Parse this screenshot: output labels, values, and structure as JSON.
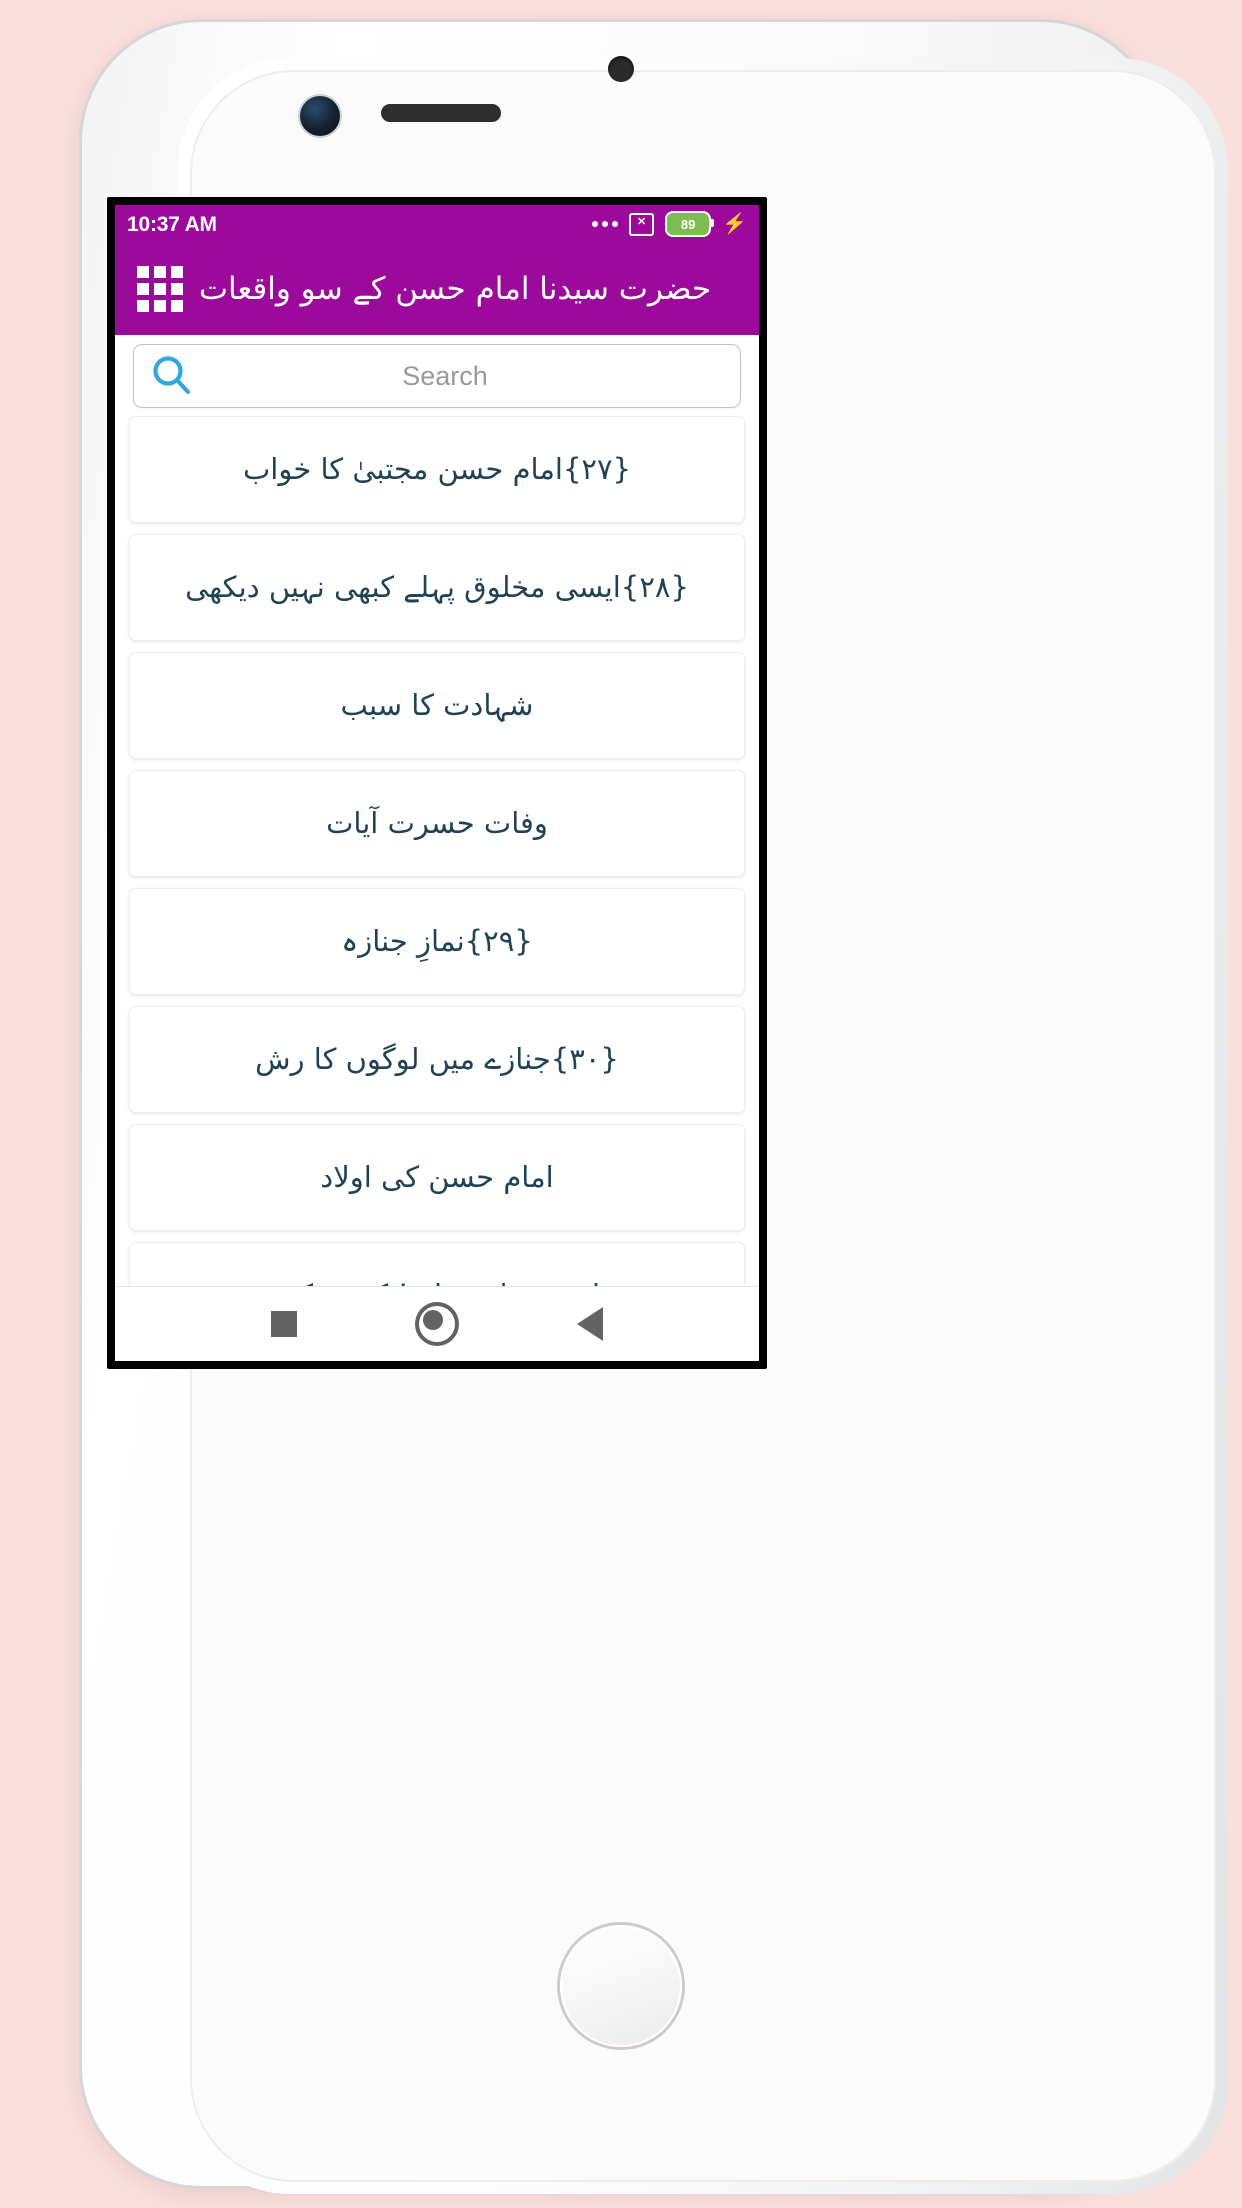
{
  "status_bar": {
    "time": "10:37 AM",
    "overflow_icon": "more-dots-icon",
    "no_sim_icon": "no-sim-icon",
    "no_sim_glyph": "✕",
    "battery_level": "89",
    "charging_icon": "bolt-icon",
    "charging_glyph": "⚡"
  },
  "app_bar": {
    "menu_icon": "grid-menu-icon",
    "title": "حضرت سیدنا امام حسن کے سو واقعات"
  },
  "search": {
    "icon": "search-icon",
    "placeholder": "Search",
    "value": ""
  },
  "list": {
    "items": [
      {
        "label": "{۲۷}امام حسن مجتبیٰ کا خواب"
      },
      {
        "label": "{۲۸}ایسی مخلوق پہلے کبھی نہیں دیکھی"
      },
      {
        "label": "شہادت کا سبب"
      },
      {
        "label": "وفات حسرت آیات"
      },
      {
        "label": "{۲۹}نمازِ جنازہ"
      },
      {
        "label": "{۳۰}جنازے میں لوگوں کا رش"
      },
      {
        "label": "امام حسن کی اولاد"
      },
      {
        "label": "یا حَسن ابنِ علی! کر دو کرم"
      }
    ]
  },
  "nav_bar": {
    "recents_icon": "square-recents-icon",
    "home_icon": "circle-home-icon",
    "back_icon": "triangle-back-icon"
  },
  "theme": {
    "accent": "#9c0a9c",
    "text": "#1f4354",
    "search_icon": "#2fa8e0",
    "battery": "#7dbd52",
    "page_background": "#fbdfdc"
  }
}
